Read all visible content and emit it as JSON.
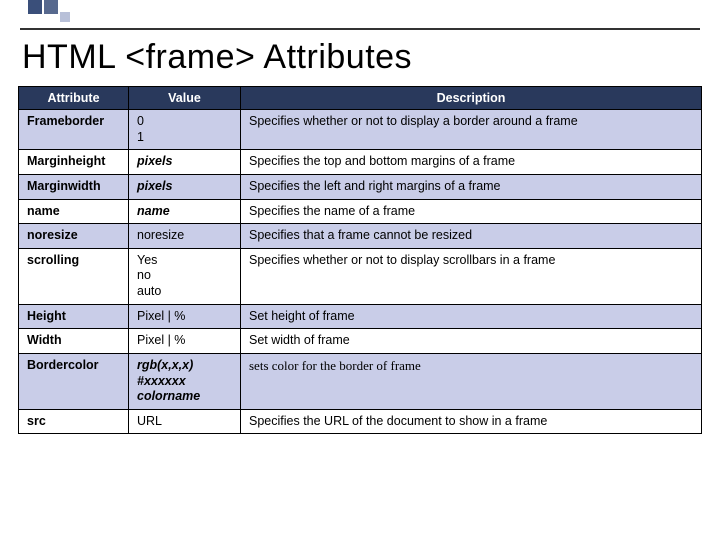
{
  "title": "HTML <frame> Attributes",
  "headers": {
    "attr": "Attribute",
    "val": "Value",
    "desc": "Description"
  },
  "rows": [
    {
      "attr": "Frameborder",
      "val": "0\n1",
      "desc": "Specifies whether or not to display a border around a frame",
      "alt": true
    },
    {
      "attr": "Marginheight",
      "val": "pixels",
      "valClass": "italic",
      "desc": "Specifies the top and bottom margins of a frame",
      "alt": false
    },
    {
      "attr": "Marginwidth",
      "val": "pixels",
      "valClass": "italic",
      "desc": "Specifies the left and right margins of a frame",
      "alt": true
    },
    {
      "attr": "name",
      "val": "name",
      "valClass": "italic",
      "desc": "Specifies the name of a frame",
      "alt": false
    },
    {
      "attr": "noresize",
      "val": "noresize",
      "desc": "Specifies that a frame cannot be resized",
      "alt": true
    },
    {
      "attr": "scrolling",
      "val": "Yes\nno\nauto",
      "desc": "Specifies whether or not to display scrollbars in a frame",
      "alt": false
    },
    {
      "attr": "Height",
      "val": "Pixel | %",
      "desc": "Set height of frame",
      "alt": true
    },
    {
      "attr": "Width",
      "val": "Pixel | %",
      "desc": "Set width of frame",
      "alt": false
    },
    {
      "attr": "Bordercolor",
      "val": "rgb(x,x,x)\n#xxxxxx\ncolorname",
      "valClass": "boldit",
      "desc": "sets color for the border of frame",
      "descClass": "serif",
      "alt": true
    },
    {
      "attr": "src",
      "val": "URL",
      "desc": "Specifies the URL of the document to show in a frame",
      "alt": false
    }
  ]
}
